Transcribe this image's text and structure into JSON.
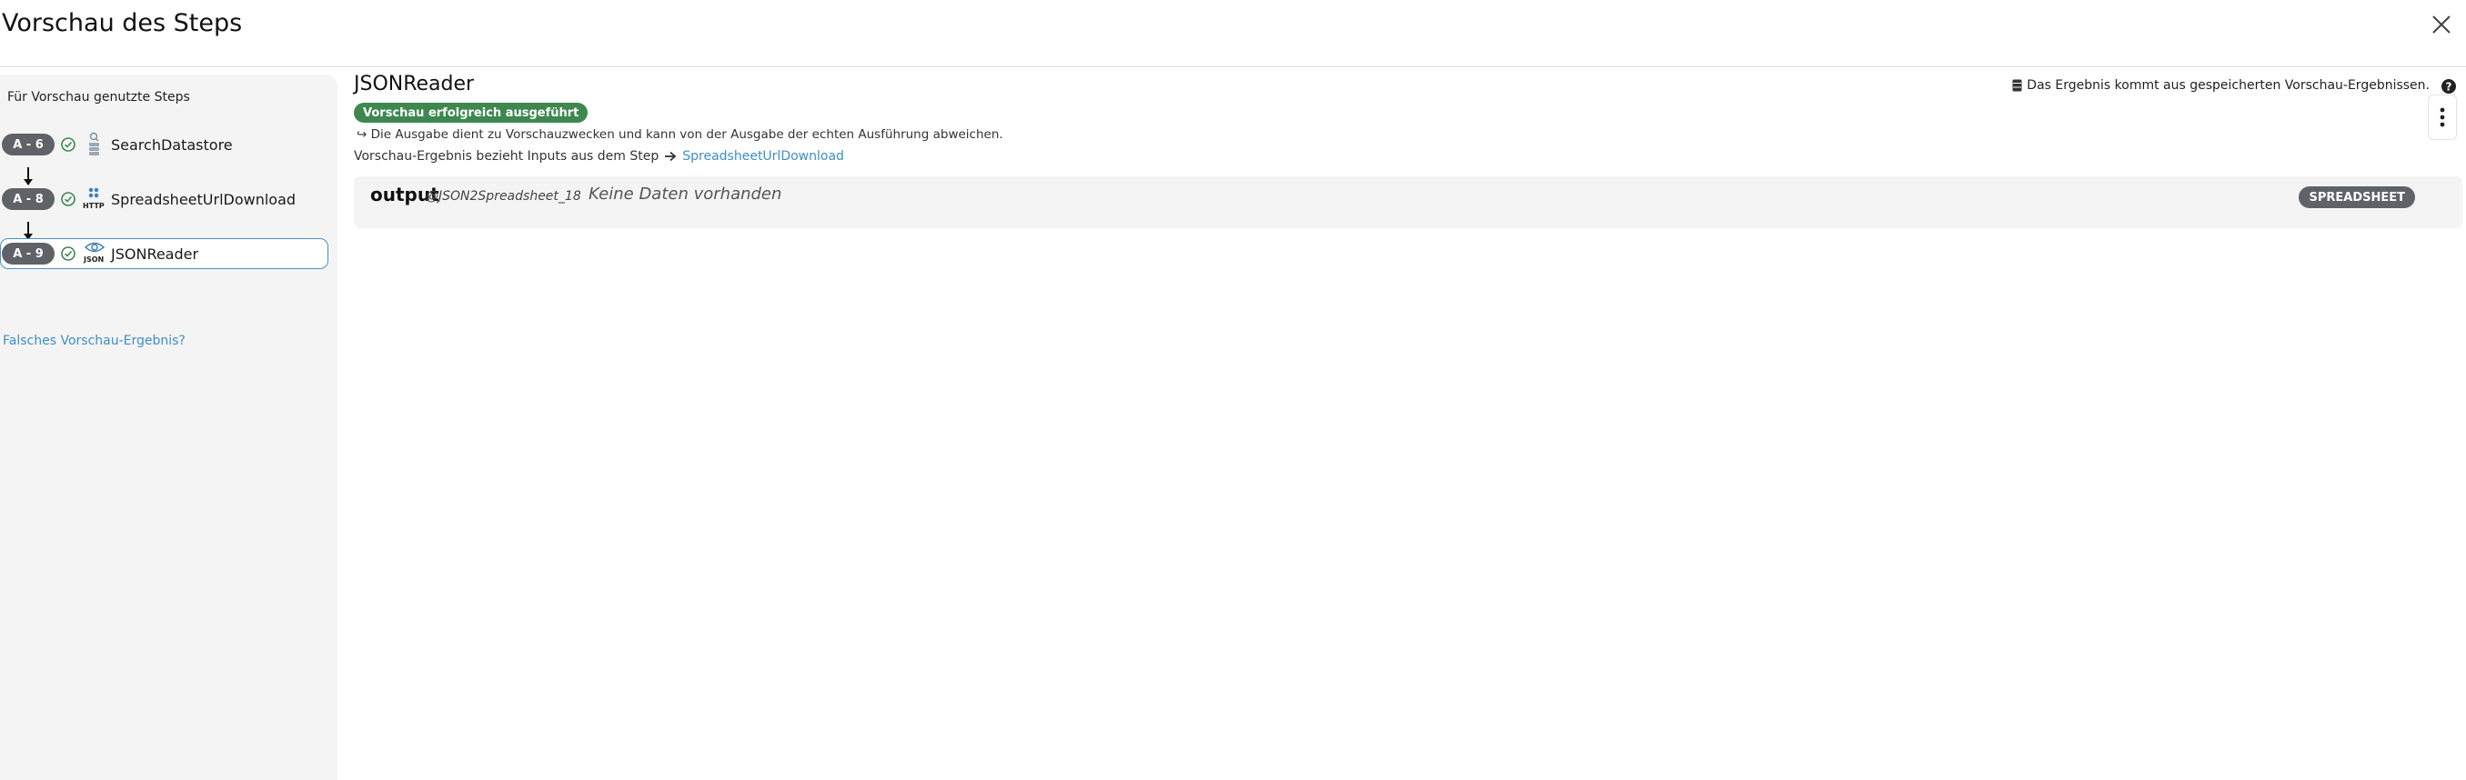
{
  "header": {
    "title": "Vorschau des Steps",
    "close_icon": "close-icon"
  },
  "sidebar": {
    "title": "Für Vorschau genutzte Steps",
    "steps": [
      {
        "badge": "A - 6",
        "label": "SearchDatastore",
        "icon": "datastore-icon",
        "status": "success"
      },
      {
        "badge": "A - 8",
        "label": "SpreadsheetUrlDownload",
        "icon": "http-icon",
        "icon_text": "HTTP",
        "status": "success"
      },
      {
        "badge": "A - 9",
        "label": "JSONReader",
        "icon": "json-eye-icon",
        "icon_text": "JSON",
        "status": "success",
        "selected": true
      }
    ],
    "wrong_result_link": "Falsches Vorschau-Ergebnis?"
  },
  "main": {
    "title": "JSONReader",
    "status_badge": "Vorschau erfolgreich ausgeführt",
    "info_text": "↪ Die Ausgabe dient zu Vorschauzwecken und kann von der Ausgabe der echten Ausführung abweichen.",
    "inputs_text": "Vorschau-Ergebnis bezieht Inputs aus dem Step",
    "inputs_step_link": "SpreadsheetUrlDownload",
    "cache_info": "Das Ergebnis kommt aus gespeicherten Vorschau-Ergebnissen.",
    "output": {
      "name": "output",
      "ref": "@JSON2Spreadsheet_18",
      "empty_text": "Keine Daten vorhanden",
      "type_badge": "SPREADSHEET"
    }
  },
  "colors": {
    "success": "#3e8850",
    "badge_gray": "#5f6368",
    "link": "#3d8fc7",
    "sidebar_bg": "#f4f4f5",
    "selected_border": "#4a90c8"
  }
}
